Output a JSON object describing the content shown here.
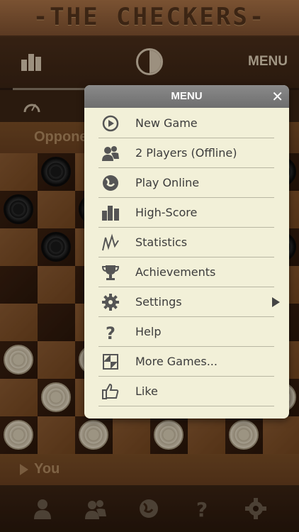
{
  "header": {
    "title": "-THE CHECKERS-"
  },
  "toolbar": {
    "menu_label": "MENU",
    "icons": [
      "highscore-icon",
      "yin-yang-icon"
    ]
  },
  "opponent": {
    "label": "Opponent"
  },
  "player": {
    "label": "You"
  },
  "bottom_bar": {
    "icons": [
      "single-player-icon",
      "two-players-icon",
      "globe-icon",
      "help-icon",
      "gear-icon"
    ]
  },
  "board": {
    "rows": 8,
    "cols": 8,
    "black_pieces": [
      [
        0,
        1
      ],
      [
        1,
        0
      ],
      [
        1,
        2
      ],
      [
        2,
        1
      ],
      [
        2,
        7
      ],
      [
        0,
        7
      ],
      [
        1,
        6
      ]
    ],
    "white_pieces": [
      [
        5,
        0
      ],
      [
        5,
        2
      ],
      [
        6,
        1
      ],
      [
        6,
        7
      ],
      [
        7,
        0
      ],
      [
        7,
        2
      ],
      [
        7,
        4
      ],
      [
        7,
        6
      ]
    ]
  },
  "menu": {
    "title": "MENU",
    "close_label": "✕",
    "items": [
      {
        "label": "New Game",
        "icon": "new-game-icon"
      },
      {
        "label": "2 Players (Offline)",
        "icon": "two-players-icon"
      },
      {
        "label": "Play Online",
        "icon": "globe-icon"
      },
      {
        "label": "High-Score",
        "icon": "highscore-icon"
      },
      {
        "label": "Statistics",
        "icon": "statistics-icon"
      },
      {
        "label": "Achievements",
        "icon": "trophy-icon"
      },
      {
        "label": "Settings",
        "icon": "gear-icon",
        "has_submenu": true
      },
      {
        "label": "Help",
        "icon": "help-icon"
      },
      {
        "label": "More Games...",
        "icon": "more-games-icon"
      },
      {
        "label": "Like",
        "icon": "thumbs-up-icon"
      }
    ]
  },
  "colors": {
    "menu_bg": "#f2f0d8",
    "menu_header": "#7a7a7a",
    "icon": "#555555"
  }
}
